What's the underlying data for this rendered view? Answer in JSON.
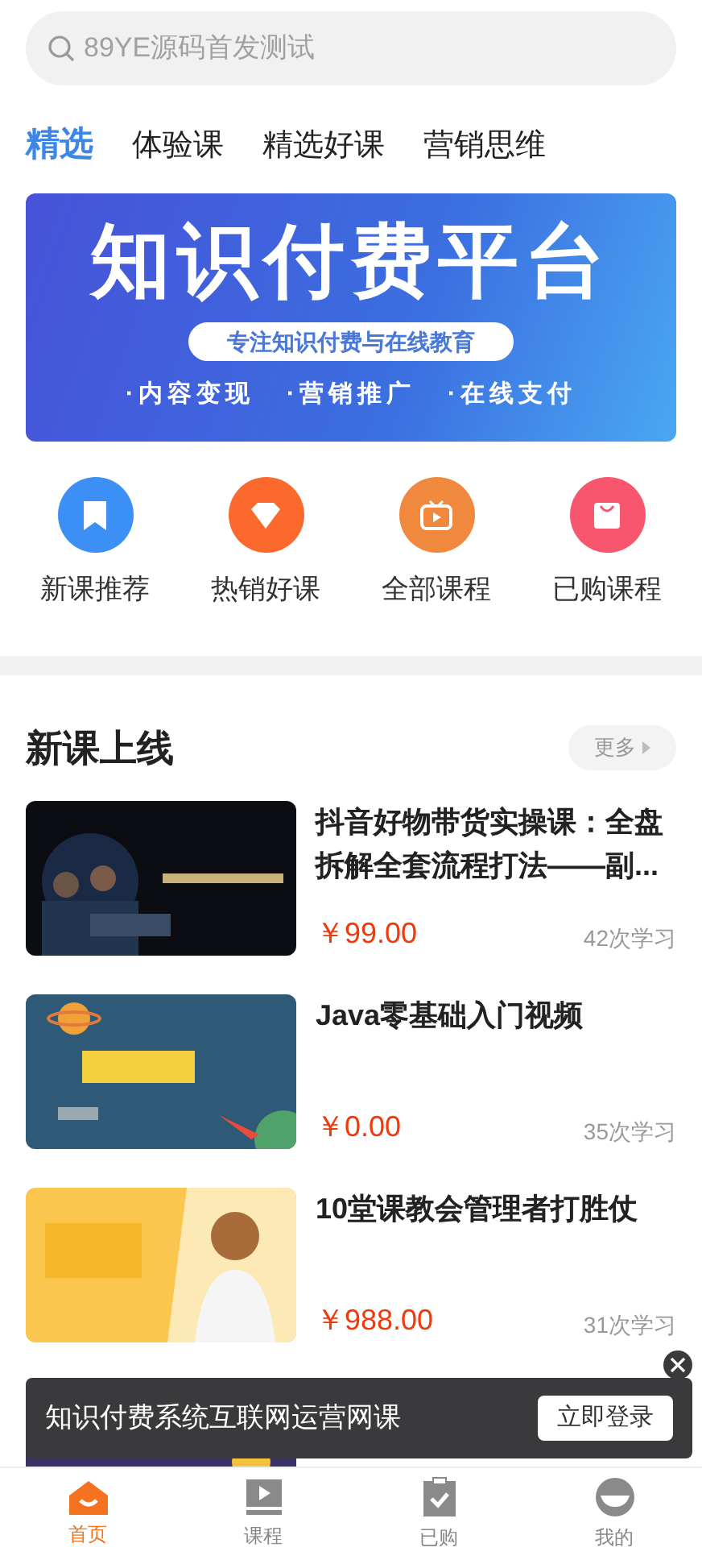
{
  "search": {
    "placeholder": "89YE源码首发测试"
  },
  "tabs": [
    {
      "label": "精选",
      "selected": true
    },
    {
      "label": "体验课",
      "selected": false
    },
    {
      "label": "精选好课",
      "selected": false
    },
    {
      "label": "营销思维",
      "selected": false
    }
  ],
  "banner": {
    "title": "知识付费平台",
    "subtitle": "专注知识付费与在线教育",
    "features": [
      "·内容变现",
      "·营销推广",
      "·在线支付"
    ]
  },
  "shortcuts": [
    {
      "label": "新课推荐",
      "color": "#3b8ff5",
      "kind": "bookmark"
    },
    {
      "label": "热销好课",
      "color": "#fb6a2c",
      "kind": "diamond"
    },
    {
      "label": "全部课程",
      "color": "#f0883e",
      "kind": "tv"
    },
    {
      "label": "已购课程",
      "color": "#f7566e",
      "kind": "bag"
    }
  ],
  "section": {
    "title": "新课上线",
    "more": "更多"
  },
  "courses": [
    {
      "title": "抖音好物带货实操课：全盘拆解全套流程打法——副...",
      "price": "￥99.00",
      "learners": "42次学习",
      "kind": "dark"
    },
    {
      "title": "Java零基础入门视频",
      "price": "￥0.00",
      "learners": "35次学习",
      "kind": "space"
    },
    {
      "title": "10堂课教会管理者打胜仗",
      "price": "￥988.00",
      "learners": "31次学习",
      "kind": "yellow"
    },
    {
      "kind": "purple"
    }
  ],
  "promo": {
    "text": "知识付费系统互联网运营网课",
    "button": "立即登录"
  },
  "nav": [
    {
      "label": "首页",
      "selected": true,
      "kind": "home"
    },
    {
      "label": "课程",
      "selected": false,
      "kind": "play"
    },
    {
      "label": "已购",
      "selected": false,
      "kind": "clipboard"
    },
    {
      "label": "我的",
      "selected": false,
      "kind": "user"
    }
  ]
}
